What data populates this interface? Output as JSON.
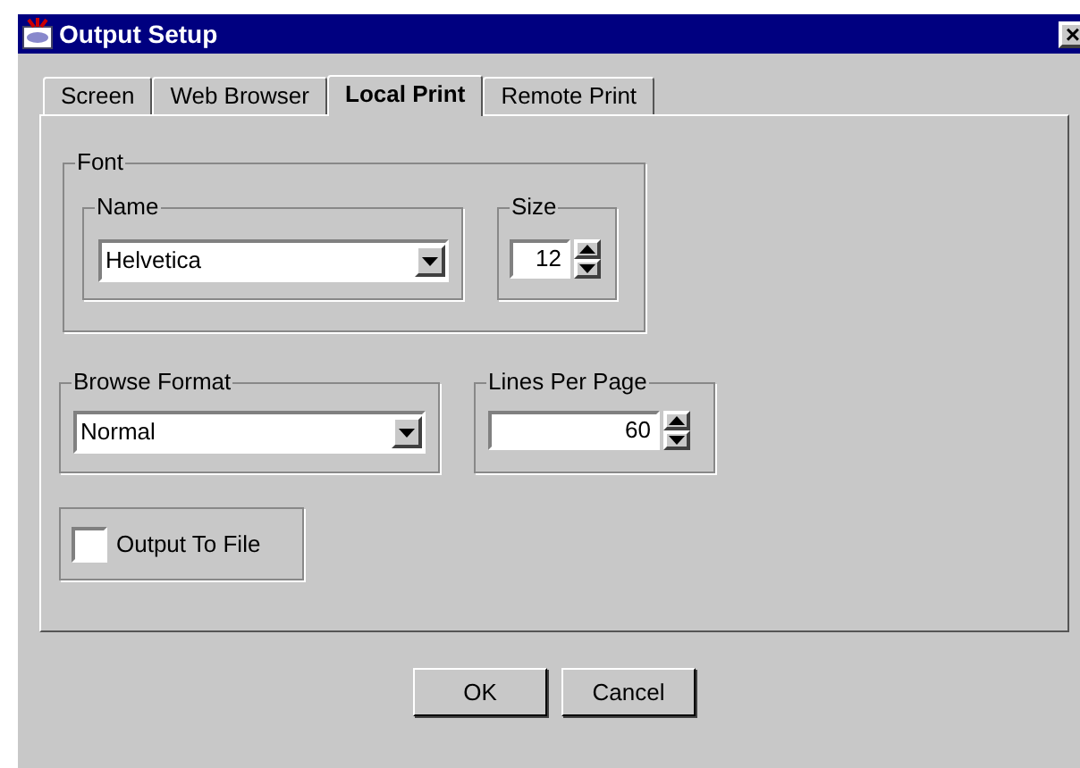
{
  "window": {
    "title": "Output Setup",
    "close": "×"
  },
  "tabs": [
    {
      "label": "Screen",
      "selected": false
    },
    {
      "label": "Web Browser",
      "selected": false
    },
    {
      "label": "Local Print",
      "selected": true
    },
    {
      "label": "Remote Print",
      "selected": false
    }
  ],
  "font_group": {
    "title": "Font",
    "name_group": {
      "title": "Name",
      "value": "Helvetica"
    },
    "size_group": {
      "title": "Size",
      "value": "12"
    }
  },
  "browse_format": {
    "title": "Browse Format",
    "value": "Normal"
  },
  "lines_per_page": {
    "title": "Lines Per Page",
    "value": "60"
  },
  "output_to_file": {
    "label": "Output To File",
    "checked": false
  },
  "buttons": [
    "OK",
    "Cancel"
  ]
}
